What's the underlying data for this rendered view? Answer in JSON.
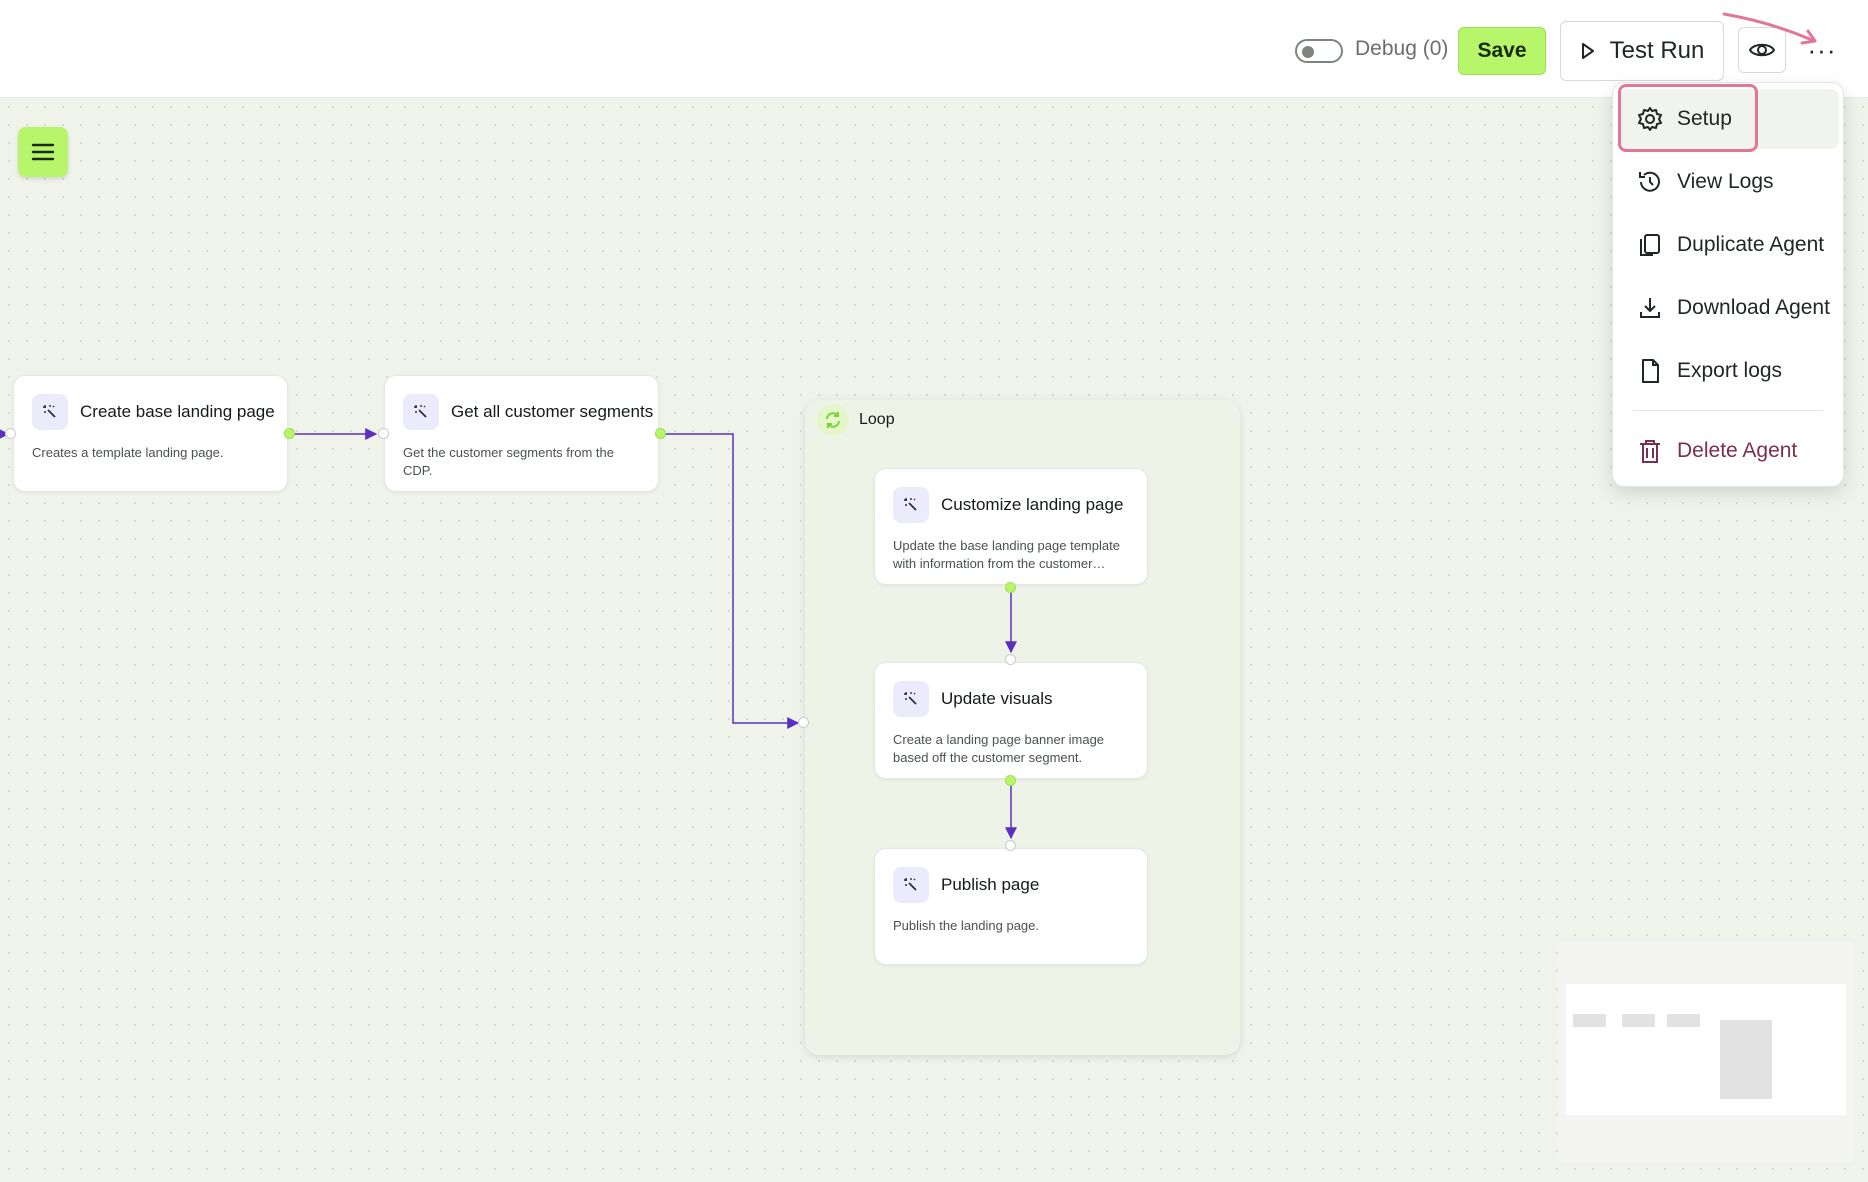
{
  "toolbar": {
    "debug_label": "Debug (0)",
    "save_label": "Save",
    "test_run_label": "Test Run",
    "more_glyph": "···"
  },
  "canvas": {
    "nodes": [
      {
        "title": "Create base landing page",
        "description": "Creates a template landing page."
      },
      {
        "title": "Get all customer segments",
        "description": "Get the customer segments from the CDP."
      }
    ],
    "loop": {
      "label": "Loop",
      "nodes": [
        {
          "title": "Customize landing page",
          "description": "Update the base landing page template with information from the customer…"
        },
        {
          "title": "Update visuals",
          "description": "Create a landing page banner image based off the customer segment."
        },
        {
          "title": "Publish page",
          "description": "Publish the landing page."
        }
      ]
    }
  },
  "menu": {
    "items": [
      {
        "label": "Setup",
        "icon": "gear-icon"
      },
      {
        "label": "View Logs",
        "icon": "history-icon"
      },
      {
        "label": "Duplicate Agent",
        "icon": "copy-icon"
      },
      {
        "label": "Download Agent",
        "icon": "download-icon"
      },
      {
        "label": "Export logs",
        "icon": "file-icon"
      },
      {
        "label": "Delete Agent",
        "icon": "trash-icon"
      }
    ]
  },
  "colors": {
    "accent": "#b7f56b",
    "edge": "#5b2fc4",
    "highlight": "#e0779a",
    "danger": "#7a2f52",
    "canvas": "#eff3ea"
  }
}
